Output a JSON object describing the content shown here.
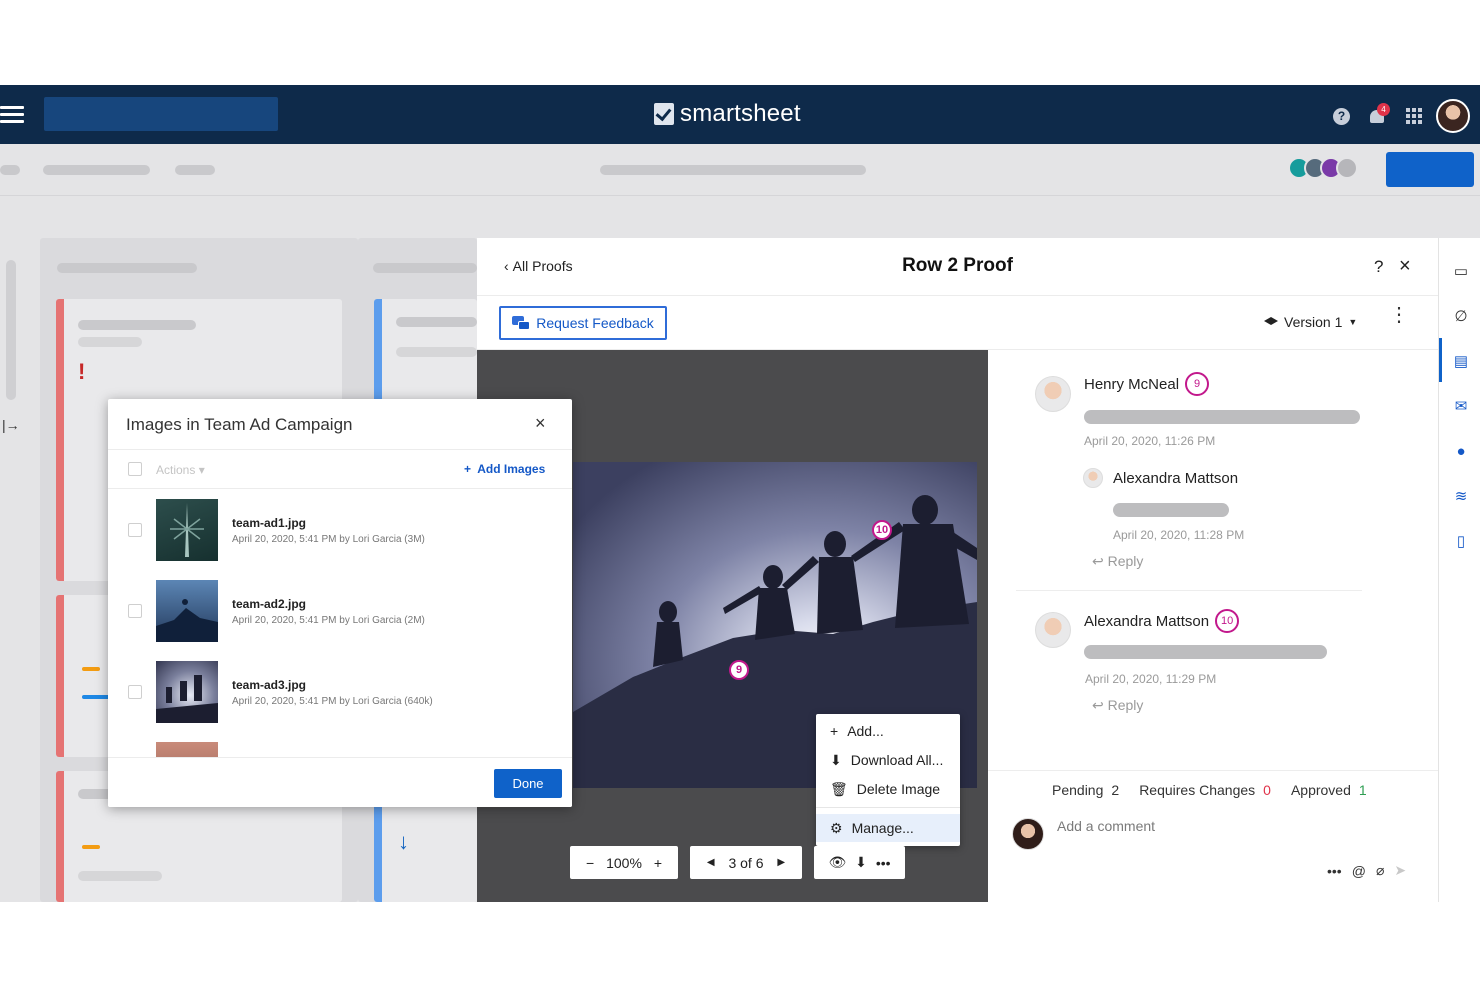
{
  "app": {
    "brand_name": "smartsheet",
    "notification_count": "4"
  },
  "proof": {
    "back_label": "All Proofs",
    "title": "Row 2 Proof",
    "help": "?",
    "close": "×",
    "request_feedback_label": "Request Feedback",
    "version_label": "Version 1",
    "markers": [
      "10",
      "9"
    ],
    "context_menu": [
      "Add...",
      "Download All...",
      "Delete Image",
      "Manage..."
    ],
    "zoom": "100%",
    "page_indicator": "3 of 6"
  },
  "comments": [
    {
      "author": "Henry McNeal",
      "count": "9",
      "timestamp": "April 20, 2020, 11:26 PM"
    },
    {
      "author": "Alexandra Mattson",
      "timestamp": "April 20, 2020, 11:28 PM",
      "reply_label": "Reply"
    },
    {
      "author": "Alexandra Mattson",
      "count": "10",
      "timestamp": "April 20, 2020, 11:29 PM",
      "reply_label": "Reply"
    }
  ],
  "status": {
    "pending_label": "Pending",
    "pending_count": "2",
    "requires_label": "Requires Changes",
    "requires_count": "0",
    "approved_label": "Approved",
    "approved_count": "1"
  },
  "comment_placeholder": "Add a comment",
  "dialog": {
    "title": "Images in Team Ad Campaign",
    "close": "×",
    "actions_label": "Actions",
    "add_images_label": "Add Images",
    "done_label": "Done",
    "images": [
      {
        "name": "team-ad1.jpg",
        "meta": "April 20, 2020, 5:41 PM by Lori Garcia (3M)"
      },
      {
        "name": "team-ad2.jpg",
        "meta": "April 20, 2020, 5:41 PM by Lori Garcia (2M)"
      },
      {
        "name": "team-ad3.jpg",
        "meta": "April 20, 2020, 5:41 PM by Lori Garcia (640k)"
      }
    ]
  },
  "colors": {
    "nav_bg": "#0e2a4a",
    "primary": "#0f62c9",
    "marker": "#c2188c",
    "danger": "#e0334a",
    "success": "#2e9e52"
  },
  "icons": [
    "hamburger-icon",
    "help-icon",
    "bell-icon",
    "apps-grid-icon",
    "chat-icon",
    "layers-icon",
    "plus-icon",
    "download-icon",
    "trash-icon",
    "gear-icon",
    "eye-icon",
    "reply-icon",
    "at-icon",
    "paperclip-icon",
    "send-icon",
    "close-icon"
  ]
}
